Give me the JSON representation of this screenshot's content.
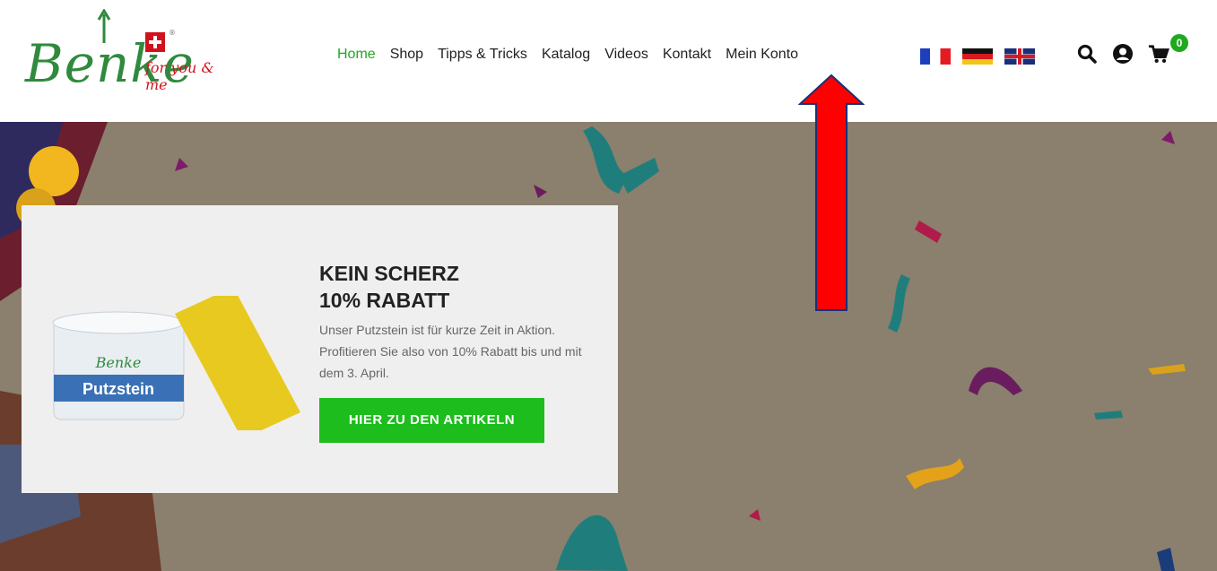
{
  "header": {
    "logo": {
      "brand_text": "Benke",
      "tagline": "for you & me"
    },
    "nav": [
      "Home",
      "Shop",
      "Tipps & Tricks",
      "Katalog",
      "Videos",
      "Kontakt",
      "Mein Konto"
    ],
    "active_nav": "Home",
    "languages": [
      "fr",
      "de",
      "en"
    ],
    "icons": [
      "search-icon",
      "account-icon",
      "cart-icon"
    ],
    "cart_count": "0"
  },
  "hero": {
    "title_line1": "KEIN SCHERZ",
    "title_line2": "10% RABATT",
    "text": "Unser Putzstein ist für kurze Zeit in Aktion. Profitieren Sie also von 10% Rabatt bis und mit dem 3. April.",
    "cta_label": "HIER ZU DEN ARTIKELN",
    "product_label": "Putzstein"
  },
  "colors": {
    "accent_green": "#1eaa1e",
    "hero_bg": "#8b7f6e",
    "annotation_red": "#ff0000"
  }
}
